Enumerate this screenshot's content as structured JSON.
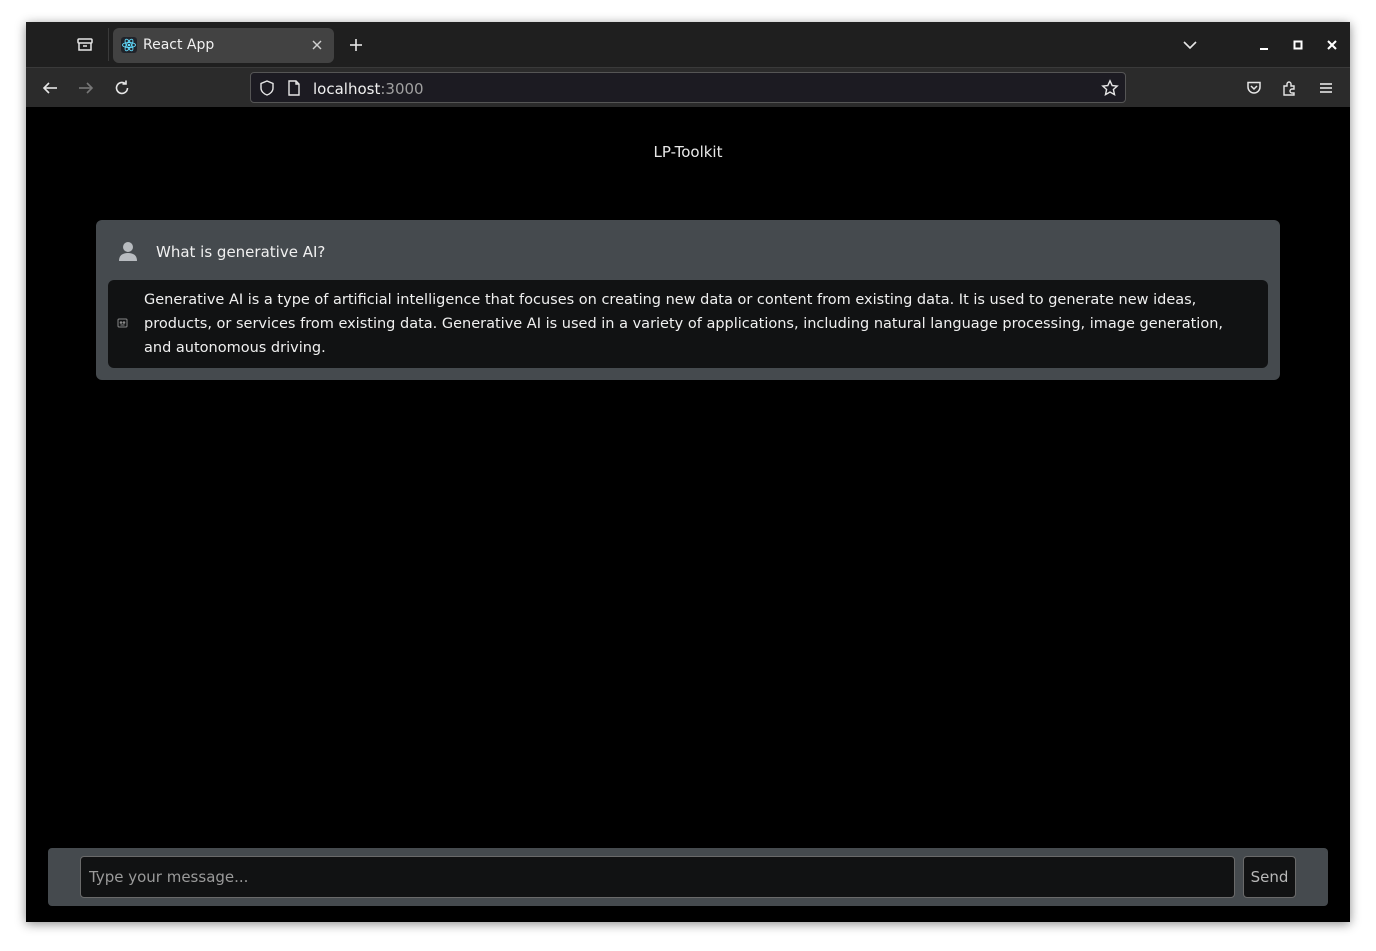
{
  "browser": {
    "tab_title": "React App",
    "url_host": "localhost",
    "url_port": ":3000"
  },
  "app": {
    "title": "LP-Toolkit"
  },
  "chat": {
    "user_message": "What is generative AI?",
    "bot_message": "Generative AI is a type of artificial intelligence that focuses on creating new data or content from existing data. It is used to generate new ideas, products, or services from existing data. Generative AI is used in a variety of applications, including natural language processing, image generation, and autonomous driving."
  },
  "composer": {
    "placeholder": "Type your message...",
    "send_label": "Send"
  }
}
